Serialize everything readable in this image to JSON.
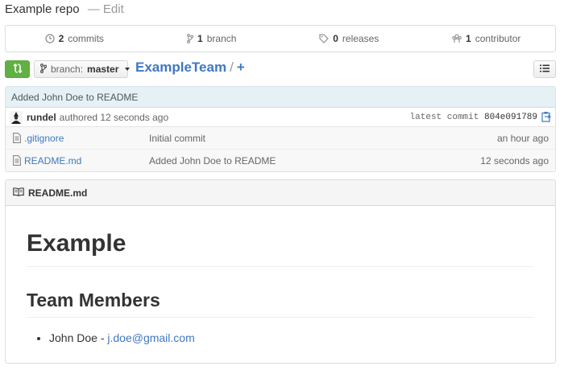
{
  "repo": {
    "title": "Example repo",
    "separator": "—",
    "edit_label": "Edit"
  },
  "stats": {
    "commits": {
      "count": "2",
      "label": "commits"
    },
    "branches": {
      "count": "1",
      "label": "branch"
    },
    "releases": {
      "count": "0",
      "label": "releases"
    },
    "contributors": {
      "count": "1",
      "label": "contributor"
    }
  },
  "toolbar": {
    "branch_prefix": "branch:",
    "branch_name": "master",
    "breadcrumb_team": "ExampleTeam",
    "breadcrumb_sep": "/",
    "breadcrumb_add": "+"
  },
  "latest_commit": {
    "message": "Added John Doe to README",
    "author": "rundel",
    "authored": "authored 12 seconds ago",
    "latest_label": "latest commit",
    "sha": "804e091789"
  },
  "files": [
    {
      "name": ".gitignore",
      "message": "Initial commit",
      "age": "an hour ago"
    },
    {
      "name": "README.md",
      "message": "Added John Doe to README",
      "age": "12 seconds ago"
    }
  ],
  "readme": {
    "filename": "README.md",
    "h1": "Example",
    "h2": "Team Members",
    "member_name": "John Doe - ",
    "member_email": "j.doe@gmail.com"
  },
  "colors": {
    "accent": "#4078c0",
    "compare_button": "#60b044",
    "commit_bar": "#e6f1f6"
  },
  "icons": [
    "history-icon",
    "git-branch-icon",
    "tag-icon",
    "organization-icon",
    "compare-icon",
    "branch-icon",
    "list-icon",
    "avatar",
    "clipboard-icon",
    "file-icon",
    "book-icon"
  ]
}
